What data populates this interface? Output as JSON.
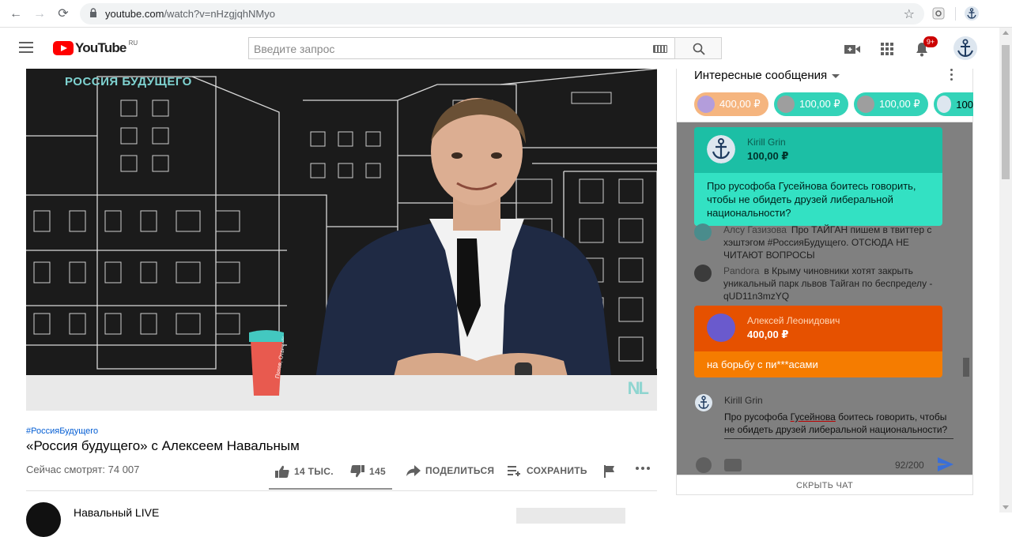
{
  "browser": {
    "url_host": "youtube.com",
    "url_path": "/watch?v=nHzgjqhNMyo"
  },
  "header": {
    "logo_text": "YouTube",
    "region": "RU",
    "search_placeholder": "Введите запрос",
    "notifications_count": "9+"
  },
  "player": {
    "overlay_title": "РОССИЯ БУДУЩЕГО",
    "cup_text": "Попов, Отвечай!",
    "brand_logo": "NL"
  },
  "video": {
    "hashtag": "#РоссияБудущего",
    "title": "«Россия будущего» с Алексеем Навальным",
    "viewers": "Сейчас смотрят: 74 007",
    "likes": "14 ТЫС.",
    "dislikes": "145",
    "share_label": "ПОДЕЛИТЬСЯ",
    "save_label": "СОХРАНИТЬ",
    "like_ratio": 0.99,
    "channel_name": "Навальный LIVE"
  },
  "chat": {
    "title": "Интересные сообщения",
    "tickers": [
      {
        "amount": "400,00 ₽",
        "bg": "#f5b57f",
        "fg": "#fff"
      },
      {
        "amount": "100,00 ₽",
        "bg": "#33d3b8",
        "fg": "#fff"
      },
      {
        "amount": "100,00 ₽",
        "bg": "#33d3b8",
        "fg": "#fff"
      },
      {
        "amount": "100",
        "bg": "#33d3b8",
        "fg": "#000"
      }
    ],
    "superchat1": {
      "author": "Kirill Grin",
      "amount": "100,00 ₽",
      "message": "Про русофоба Гусейнова боитесь говорить, чтобы не обидеть друзей либеральной национальности?",
      "head_color": "#1cbfa5",
      "body_color": "#33e1c3"
    },
    "messages": [
      {
        "author": "Алсу Газизова",
        "text": "Про ТАЙГАН пишем в твиттер с хэштэгом #РоссияБудущего. ОТСЮДА НЕ ЧИТАЮТ ВОПРОСЫ"
      },
      {
        "author": "Pandora",
        "text": "в Крыму чиновники хотят закрыть уникальный парк львов Тайган по беспределу - qUD11n3mzYQ"
      }
    ],
    "superchat2": {
      "author": "Алексей Леонидович",
      "amount": "400,00 ₽",
      "message": "на борьбу с пи***асами",
      "head_color": "#e65100",
      "body_color": "#f57c00"
    },
    "input": {
      "author": "Kirill Grin",
      "text_pre": "Про русофоба ",
      "text_ul": "Гусейнова",
      "text_post": " боитесь говорить, чтобы не обидеть друзей либеральной национальности?",
      "char_count": "92/200"
    },
    "hide_chat_label": "СКРЫТЬ ЧАТ"
  }
}
